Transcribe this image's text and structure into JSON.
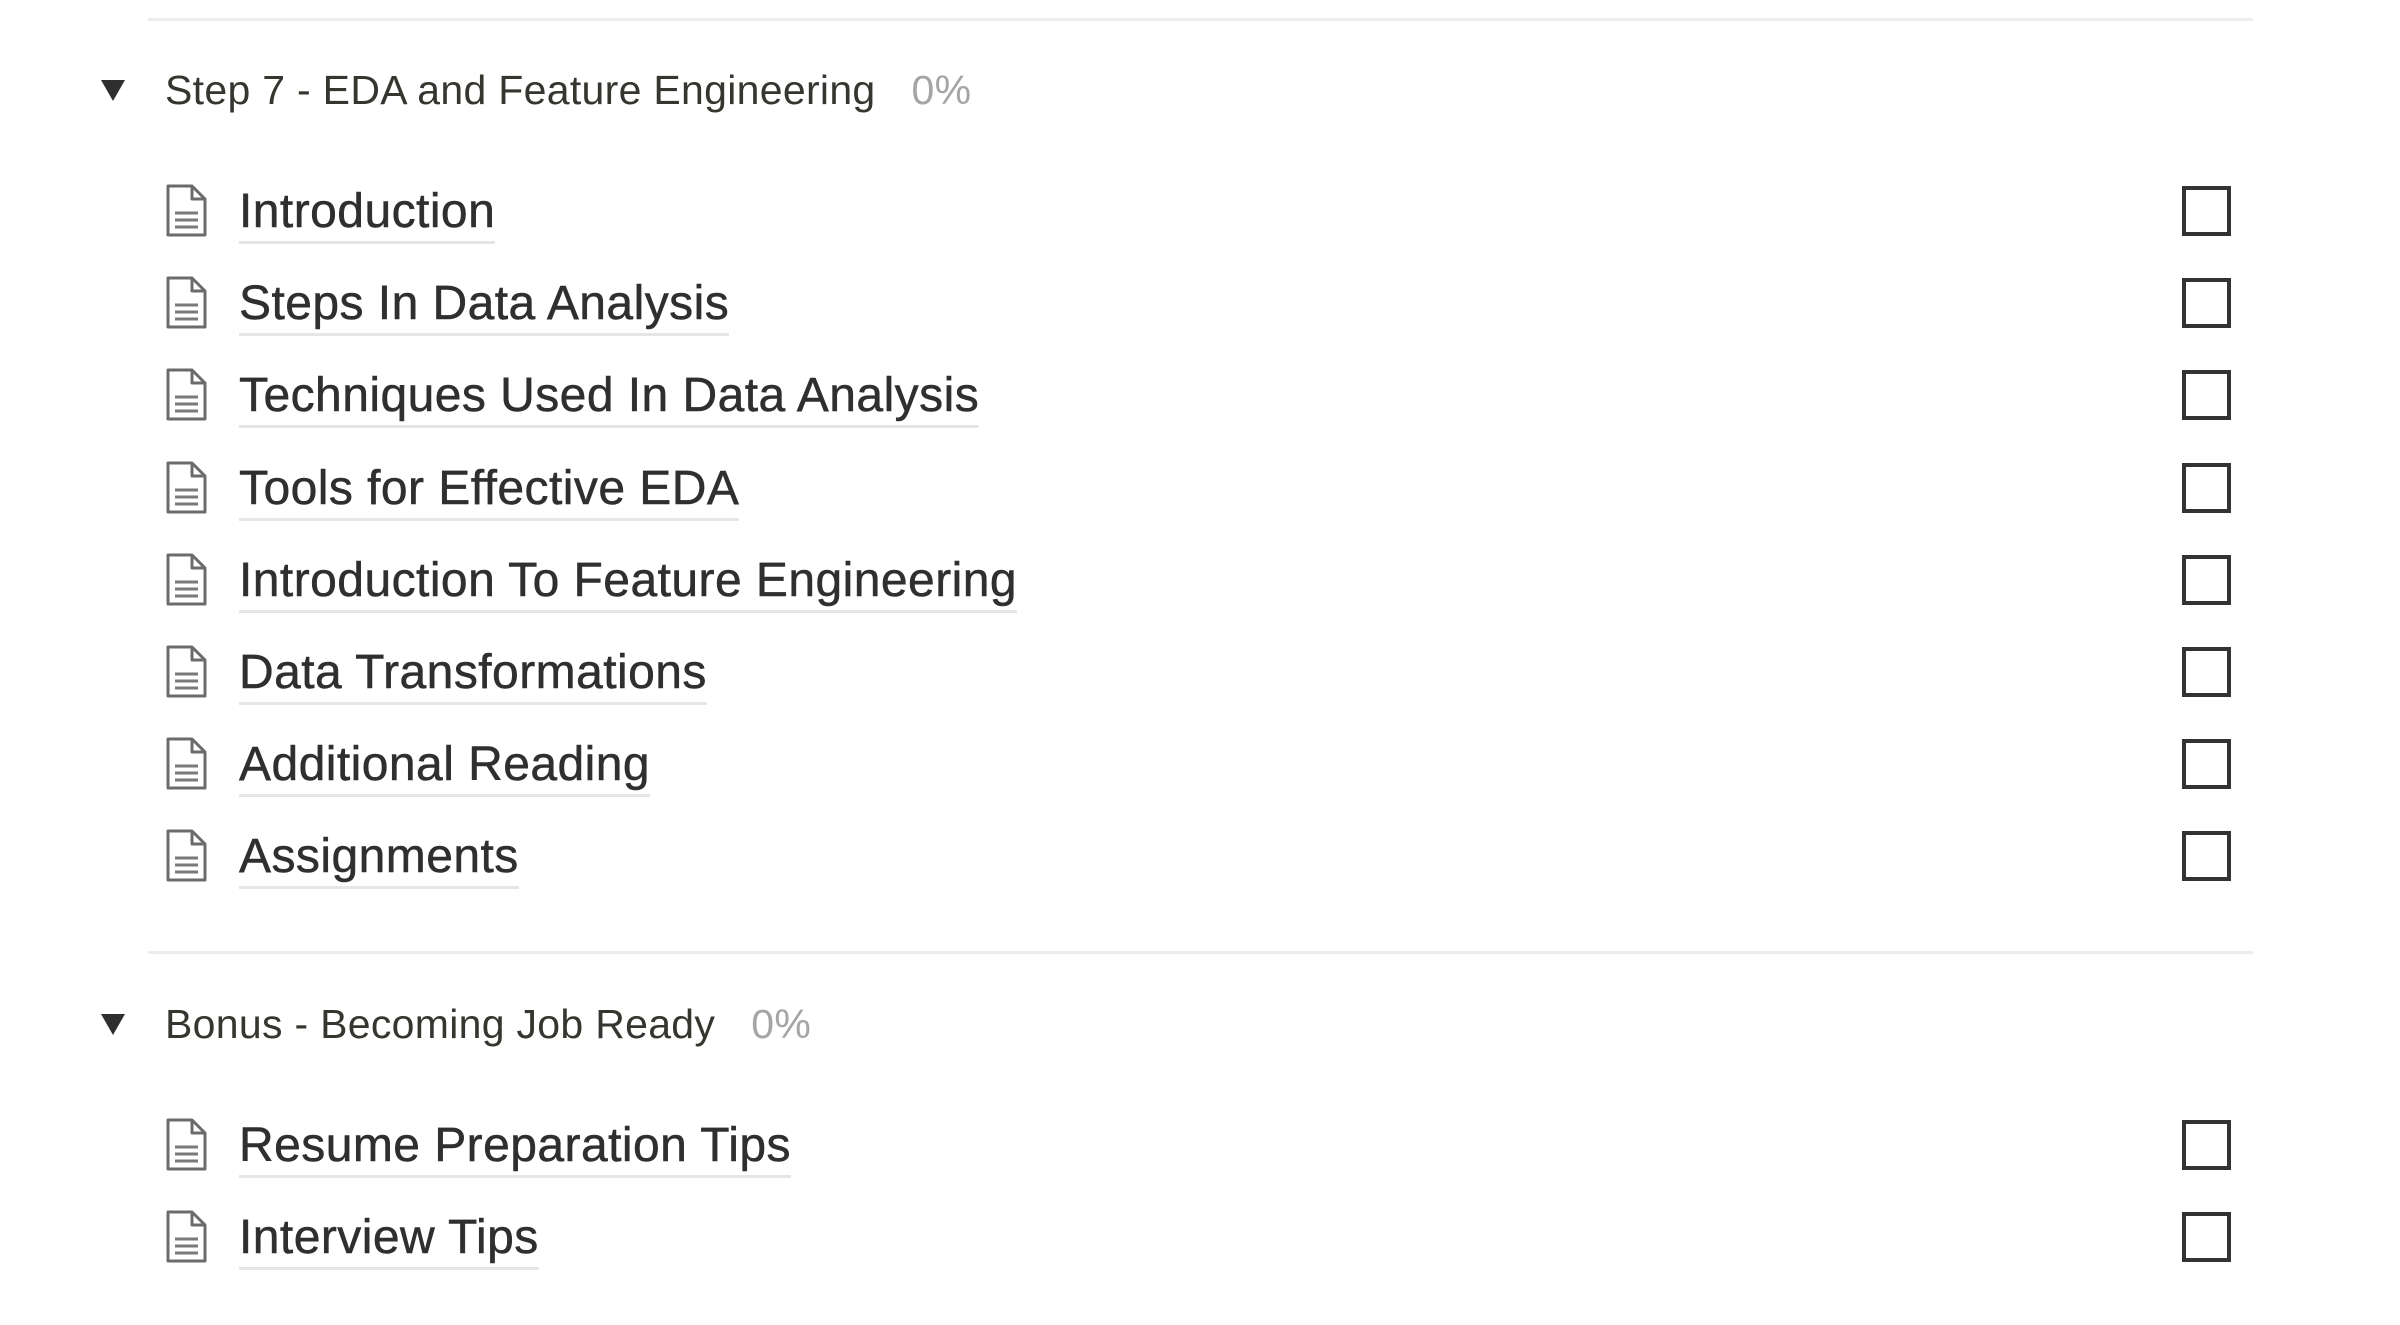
{
  "sections": [
    {
      "title": "Step 7 - EDA and Feature Engineering",
      "progress_label": "0%",
      "progress": 0,
      "expanded": true,
      "toggle_icon": "triangle-down-icon",
      "items": [
        {
          "label": "Introduction",
          "icon": "page-icon",
          "checked": false
        },
        {
          "label": "Steps In Data Analysis",
          "icon": "page-icon",
          "checked": false
        },
        {
          "label": "Techniques Used In Data Analysis",
          "icon": "page-icon",
          "checked": false
        },
        {
          "label": "Tools for Effective EDA",
          "icon": "page-icon",
          "checked": false
        },
        {
          "label": "Introduction To Feature Engineering",
          "icon": "page-icon",
          "checked": false
        },
        {
          "label": "Data Transformations",
          "icon": "page-icon",
          "checked": false
        },
        {
          "label": "Additional Reading",
          "icon": "page-icon",
          "checked": false
        },
        {
          "label": "Assignments",
          "icon": "page-icon",
          "checked": false
        }
      ]
    },
    {
      "title": "Bonus - Becoming Job Ready",
      "progress_label": "0%",
      "progress": 0,
      "expanded": true,
      "toggle_icon": "triangle-down-icon",
      "items": [
        {
          "label": "Resume Preparation Tips",
          "icon": "page-icon",
          "checked": false
        },
        {
          "label": "Interview Tips",
          "icon": "page-icon",
          "checked": false
        }
      ]
    }
  ],
  "colors": {
    "text": "#37352f",
    "link_text": "#2f2f2f",
    "muted": "#a5a5a3",
    "divider": "#ededec",
    "checkbox_border": "#333333"
  }
}
